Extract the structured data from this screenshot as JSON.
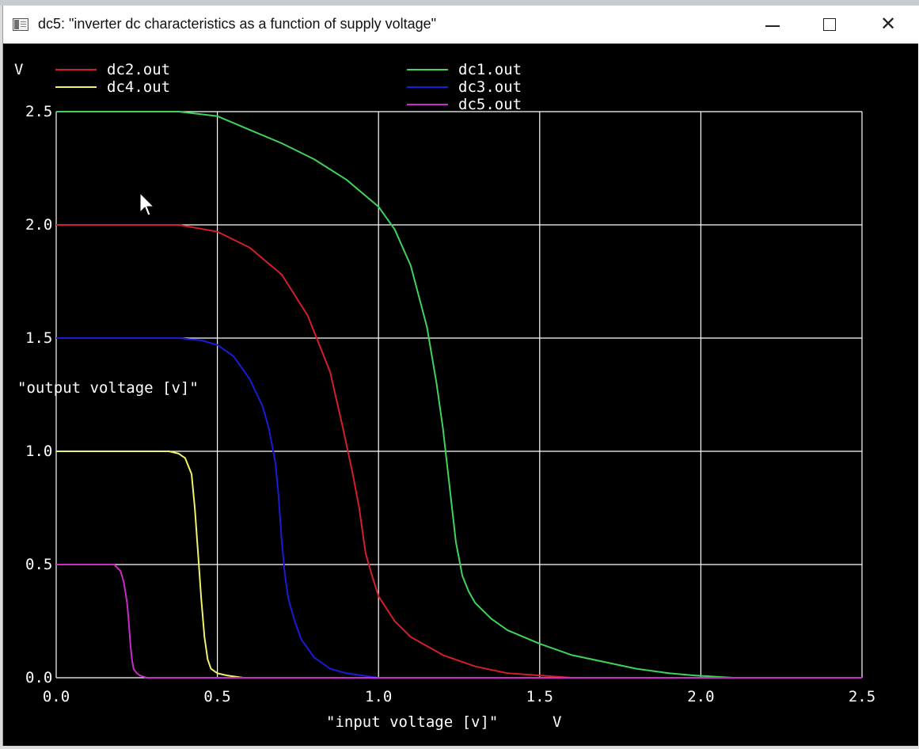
{
  "window": {
    "title": "dc5: \"inverter dc characteristics as a function of supply voltage\"",
    "buttons": {
      "minimize": "minimize",
      "maximize": "maximize",
      "close": "✕"
    }
  },
  "chart_data": {
    "type": "line",
    "title": "",
    "xlabel": "\"input voltage [v]\"",
    "xunit": "V",
    "ylabel": "\"output voltage [v]\"",
    "yunit": "V",
    "xlim": [
      0,
      2.5
    ],
    "ylim": [
      0,
      2.5
    ],
    "xticks": [
      "0.0",
      "0.5",
      "1.0",
      "1.5",
      "2.0",
      "2.5"
    ],
    "yticks": [
      "0.0",
      "0.5",
      "1.0",
      "1.5",
      "2.0",
      "2.5"
    ],
    "xtick_values": [
      0,
      0.5,
      1.0,
      1.5,
      2.0,
      2.5
    ],
    "ytick_values": [
      0,
      0.5,
      1.0,
      1.5,
      2.0,
      2.5
    ],
    "grid": true,
    "legend_position": "top",
    "colors": {
      "background": "#000000",
      "grid": "#ffffff",
      "text": "#ffffff"
    },
    "series": [
      {
        "name": "dc2.out",
        "color": "#d41f2a",
        "x": [
          0,
          0.2,
          0.38,
          0.5,
          0.6,
          0.7,
          0.78,
          0.85,
          0.89,
          0.92,
          0.94,
          0.95,
          0.96,
          0.98,
          1.0,
          1.05,
          1.1,
          1.2,
          1.3,
          1.4,
          1.5,
          1.6,
          1.8,
          2.0,
          2.5
        ],
        "y": [
          2.0,
          2.0,
          2.0,
          1.97,
          1.9,
          1.78,
          1.6,
          1.35,
          1.1,
          0.9,
          0.75,
          0.65,
          0.55,
          0.45,
          0.36,
          0.25,
          0.18,
          0.1,
          0.05,
          0.02,
          0.01,
          0.0,
          0.0,
          0.0,
          0.0
        ]
      },
      {
        "name": "dc1.out",
        "color": "#3fd35a",
        "x": [
          0,
          0.2,
          0.38,
          0.5,
          0.6,
          0.7,
          0.8,
          0.9,
          1.0,
          1.05,
          1.1,
          1.15,
          1.18,
          1.2,
          1.22,
          1.24,
          1.26,
          1.28,
          1.3,
          1.35,
          1.4,
          1.5,
          1.6,
          1.7,
          1.8,
          1.9,
          1.98,
          2.1,
          2.5
        ],
        "y": [
          2.5,
          2.5,
          2.5,
          2.48,
          2.42,
          2.36,
          2.29,
          2.2,
          2.08,
          1.98,
          1.82,
          1.55,
          1.3,
          1.1,
          0.85,
          0.6,
          0.45,
          0.38,
          0.33,
          0.26,
          0.21,
          0.15,
          0.1,
          0.07,
          0.04,
          0.02,
          0.01,
          0.0,
          0.0
        ]
      },
      {
        "name": "dc4.out",
        "color": "#f2f26a",
        "x": [
          0,
          0.15,
          0.35,
          0.38,
          0.4,
          0.42,
          0.43,
          0.44,
          0.45,
          0.46,
          0.47,
          0.48,
          0.5,
          0.53,
          0.58,
          0.7,
          2.5
        ],
        "y": [
          1.0,
          1.0,
          1.0,
          0.99,
          0.97,
          0.9,
          0.75,
          0.55,
          0.35,
          0.18,
          0.08,
          0.04,
          0.02,
          0.01,
          0.0,
          0.0,
          0.0
        ]
      },
      {
        "name": "dc3.out",
        "color": "#1a1ad8",
        "x": [
          0,
          0.2,
          0.38,
          0.45,
          0.5,
          0.55,
          0.6,
          0.64,
          0.66,
          0.68,
          0.69,
          0.7,
          0.71,
          0.72,
          0.74,
          0.76,
          0.8,
          0.85,
          0.9,
          0.95,
          1.0,
          2.5
        ],
        "y": [
          1.5,
          1.5,
          1.5,
          1.49,
          1.47,
          1.42,
          1.32,
          1.2,
          1.1,
          0.95,
          0.8,
          0.6,
          0.45,
          0.35,
          0.25,
          0.17,
          0.09,
          0.04,
          0.02,
          0.01,
          0.0,
          0.0
        ]
      },
      {
        "name": "dc5.out",
        "color": "#c92bc9",
        "x": [
          0,
          0.1,
          0.18,
          0.2,
          0.21,
          0.22,
          0.225,
          0.23,
          0.235,
          0.24,
          0.25,
          0.26,
          0.28,
          0.3,
          2.5
        ],
        "y": [
          0.5,
          0.5,
          0.5,
          0.47,
          0.42,
          0.33,
          0.25,
          0.15,
          0.08,
          0.04,
          0.02,
          0.01,
          0.0,
          0.0,
          0.0
        ]
      }
    ]
  }
}
